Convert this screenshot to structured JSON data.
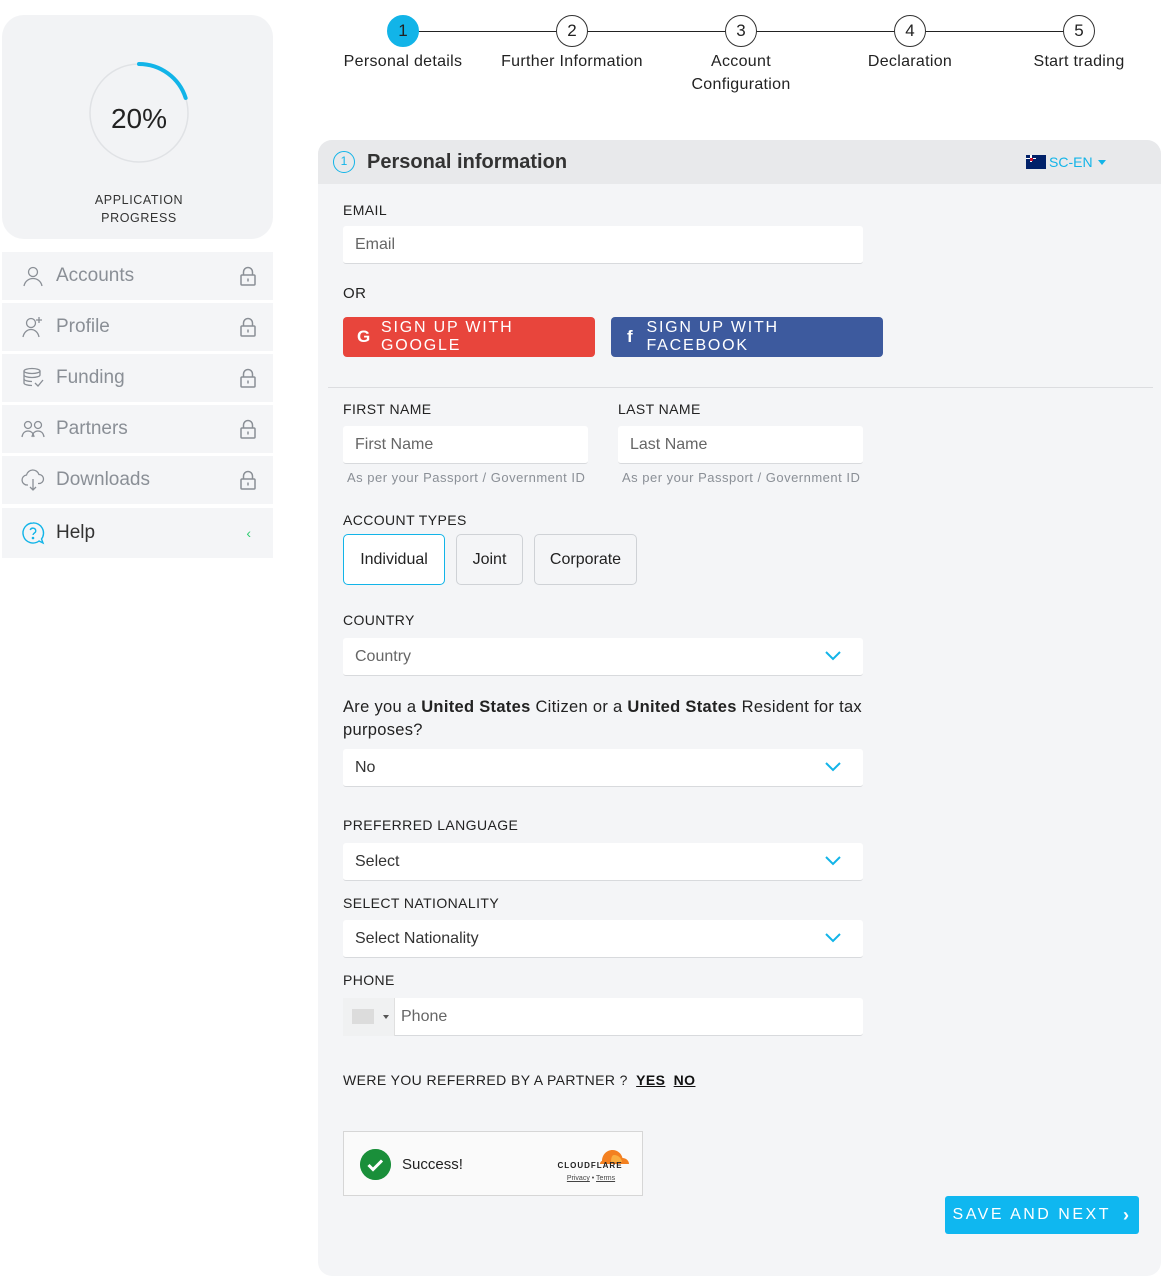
{
  "progress": {
    "percent_text": "20%",
    "percent": 0.2,
    "label": "APPLICATION\nPROGRESS"
  },
  "nav": [
    {
      "label": "Accounts",
      "icon": "user-icon",
      "locked": true
    },
    {
      "label": "Profile",
      "icon": "user-plus-icon",
      "locked": true
    },
    {
      "label": "Funding",
      "icon": "coins-icon",
      "locked": true
    },
    {
      "label": "Partners",
      "icon": "users-icon",
      "locked": true
    },
    {
      "label": "Downloads",
      "icon": "cloud-download-icon",
      "locked": true
    },
    {
      "label": "Help",
      "icon": "help-icon",
      "locked": false
    }
  ],
  "steps": [
    {
      "num": "1",
      "label": "Personal details",
      "active": true
    },
    {
      "num": "2",
      "label": "Further Information",
      "active": false
    },
    {
      "num": "3",
      "label": "Account Configuration",
      "active": false
    },
    {
      "num": "4",
      "label": "Declaration",
      "active": false
    },
    {
      "num": "5",
      "label": "Start trading",
      "active": false
    }
  ],
  "section": {
    "num": "1",
    "title": "Personal information",
    "lang": "SC-EN"
  },
  "form": {
    "email_label": "EMAIL",
    "email_placeholder": "Email",
    "or_label": "OR",
    "google_btn": "SIGN UP WITH GOOGLE",
    "facebook_btn": "SIGN UP WITH FACEBOOK",
    "first_name_label": "FIRST NAME",
    "first_name_placeholder": "First Name",
    "last_name_label": "LAST NAME",
    "last_name_placeholder": "Last Name",
    "id_hint": "As per your Passport / Government ID",
    "account_types_label": "ACCOUNT TYPES",
    "account_types": [
      "Individual",
      "Joint",
      "Corporate"
    ],
    "account_type_selected": "Individual",
    "country_label": "COUNTRY",
    "country_value": "Country",
    "us_question_pre": "Are you a ",
    "us_question_bold1": "United States",
    "us_question_mid": " Citizen or a ",
    "us_question_bold2": "United States",
    "us_question_post": " Resident for tax purposes?",
    "us_value": "No",
    "language_label": "PREFERRED LANGUAGE",
    "language_value": "Select",
    "nationality_label": "SELECT NATIONALITY",
    "nationality_value": "Select Nationality",
    "phone_label": "PHONE",
    "phone_placeholder": "Phone",
    "referred_label": "WERE YOU REFERRED BY A PARTNER ?",
    "referred_yes": "YES",
    "referred_no": "NO"
  },
  "captcha": {
    "message": "Success!",
    "brand": "CLOUDFLARE",
    "privacy": "Privacy",
    "sep": " • ",
    "terms": "Terms"
  },
  "save_btn": "SAVE AND NEXT",
  "colors": {
    "accent": "#12b4e8",
    "google": "#e8453c",
    "facebook": "#3d5a9e",
    "success": "#1a8f3a"
  }
}
